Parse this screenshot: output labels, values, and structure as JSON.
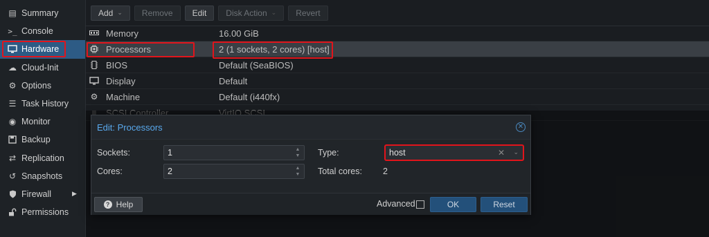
{
  "sidebar": {
    "items": [
      {
        "label": "Summary",
        "icon": "book-icon"
      },
      {
        "label": "Console",
        "icon": "terminal-icon"
      },
      {
        "label": "Hardware",
        "icon": "monitor-icon"
      },
      {
        "label": "Cloud-Init",
        "icon": "cloud-icon"
      },
      {
        "label": "Options",
        "icon": "gear-icon"
      },
      {
        "label": "Task History",
        "icon": "list-icon"
      },
      {
        "label": "Monitor",
        "icon": "eye-icon"
      },
      {
        "label": "Backup",
        "icon": "floppy-icon"
      },
      {
        "label": "Replication",
        "icon": "sync-icon"
      },
      {
        "label": "Snapshots",
        "icon": "history-icon"
      },
      {
        "label": "Firewall",
        "icon": "shield-icon"
      },
      {
        "label": "Permissions",
        "icon": "unlock-icon"
      }
    ],
    "active": "Hardware"
  },
  "toolbar": {
    "add": "Add",
    "remove": "Remove",
    "edit": "Edit",
    "disk_action": "Disk Action",
    "revert": "Revert"
  },
  "hardware": {
    "rows": [
      {
        "key": "Memory",
        "value": "16.00 GiB",
        "icon": "memory-icon"
      },
      {
        "key": "Processors",
        "value": "2 (1 sockets, 2 cores) [host]",
        "icon": "cpu-icon"
      },
      {
        "key": "BIOS",
        "value": "Default (SeaBIOS)",
        "icon": "chip-icon"
      },
      {
        "key": "Display",
        "value": "Default",
        "icon": "display-icon"
      },
      {
        "key": "Machine",
        "value": "Default (i440fx)",
        "icon": "cogs-icon"
      },
      {
        "key": "SCSI Controller",
        "value": "VirtIO SCSI",
        "icon": "database-icon"
      }
    ]
  },
  "dialog": {
    "title": "Edit: Processors",
    "sockets_label": "Sockets:",
    "sockets_value": "1",
    "cores_label": "Cores:",
    "cores_value": "2",
    "type_label": "Type:",
    "type_value": "host",
    "total_cores_label": "Total cores:",
    "total_cores_value": "2",
    "help": "Help",
    "advanced": "Advanced",
    "ok": "OK",
    "reset": "Reset"
  },
  "colors": {
    "accent": "#2d5b85",
    "highlight": "#e2141b",
    "title": "#59a9ee"
  }
}
